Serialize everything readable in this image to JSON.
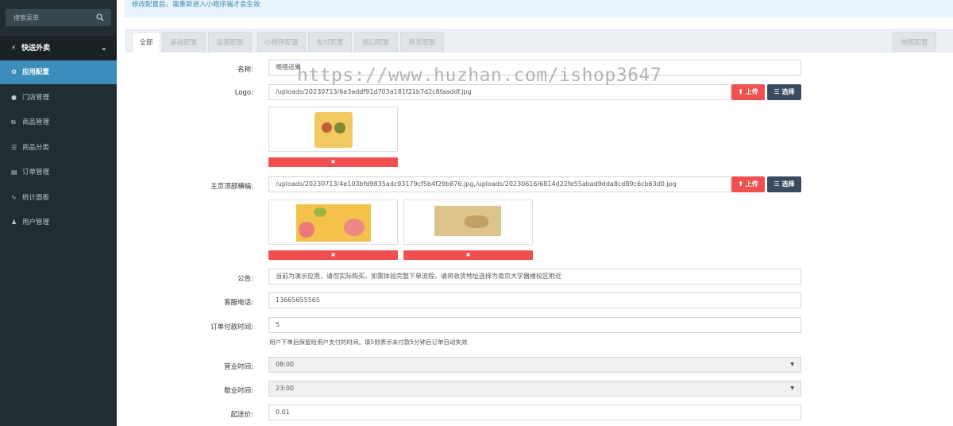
{
  "sidebar": {
    "search_placeholder": "搜索菜单",
    "group_label": "快送外卖",
    "items": [
      {
        "label": "应用配置",
        "icon": "gear-icon",
        "glyph": "⚙"
      },
      {
        "label": "门店管理",
        "icon": "map-marker-icon",
        "glyph": "📍"
      },
      {
        "label": "商品管理",
        "icon": "cubes-icon",
        "glyph": "⧉"
      },
      {
        "label": "商品分类",
        "icon": "list-icon",
        "glyph": "☰"
      },
      {
        "label": "订单管理",
        "icon": "file-icon",
        "glyph": "▤"
      },
      {
        "label": "统计面板",
        "icon": "line-chart-icon",
        "glyph": "📈"
      },
      {
        "label": "用户管理",
        "icon": "users-icon",
        "glyph": "👥"
      }
    ]
  },
  "alert": {
    "text": "修改配置后，需重新进入小程序端才会生效"
  },
  "tabs": [
    "全部",
    "基础配置",
    "运营配置",
    "小程序配置",
    "支付配置",
    "接口配置",
    "转发配置",
    "地图配置"
  ],
  "form": {
    "name": {
      "label": "名称:",
      "value": "嘀嗒送果"
    },
    "logo": {
      "label": "Logo:",
      "value": "/uploads/20230713/6e3addf91d703a181f21b7d2c8faaddf.jpg"
    },
    "banner": {
      "label": "主页顶部横幅:",
      "value": "/uploads/20230713/4e103bfd9835adc93179cf5b4f29b876.jpg,/uploads/20230616/6814d22fe55abad9dda8cd89c6cb63d0.jpg"
    },
    "notice": {
      "label": "公告:",
      "value": "当前为演示应用，请勿实际购买。如需体验完整下单流程，请将收货地址选择为南京大学器楼校区附近"
    },
    "phone": {
      "label": "客服电话:",
      "value": "13665655565"
    },
    "pay_time": {
      "label": "订单付款时间:",
      "value": "5",
      "help": "用户下单后保留给用户支付的时间。填5则表示未付款5分钟后订单自动失效"
    },
    "open_time": {
      "label": "营业时间:",
      "value": "08:00"
    },
    "close_time": {
      "label": "歇业时间:",
      "value": "23:00"
    },
    "min_price": {
      "label": "起送价:",
      "value": "0.01"
    }
  },
  "buttons": {
    "upload": "上传",
    "choose": "选择",
    "delete_glyph": "🗑"
  },
  "watermark": "https://www.huzhan.com/ishop3647"
}
